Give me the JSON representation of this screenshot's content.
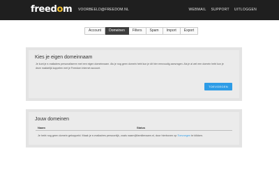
{
  "header": {
    "logo_text": "freedom",
    "account_email": "VOORBEELD@FREEDOM.NL",
    "nav": [
      "WEBMAIL",
      "SUPPORT",
      "UITLOGGEN"
    ]
  },
  "tabs": [
    {
      "label": "Account",
      "active": false
    },
    {
      "label": "Domeinen",
      "active": true
    },
    {
      "label": "Filters",
      "active": false
    },
    {
      "label": "Spam",
      "active": false
    },
    {
      "label": "Import",
      "active": false
    },
    {
      "label": "Export",
      "active": false
    }
  ],
  "custom_domain": {
    "title": "Kies je eigen domeinnaam",
    "description": "Je kunt je e-mailadres personaliseren met een eigen domeinnaam. Als je nog geen domein hebt kun je dit hier eenvoudig aanvragen. Als je al wel een domein hebt kun je deze makkelijk koppelen met je Freedom Internet account.",
    "button_label": "TOEVOEGEN"
  },
  "domains": {
    "title": "Jouw domeinen",
    "columns": [
      "Naam",
      "Status"
    ],
    "empty_text": "Je hebt nog geen domein gekoppeld. Maak je e-mailadres persoonlijk, zoals naam@familienaam.nl, door hierboven op",
    "empty_link": "Toevoegen",
    "empty_suffix": "te klikken."
  },
  "colors": {
    "topbar": "#1f1f1f",
    "accent": "#2e9ce6",
    "logo_dot": "#f2c12e"
  }
}
